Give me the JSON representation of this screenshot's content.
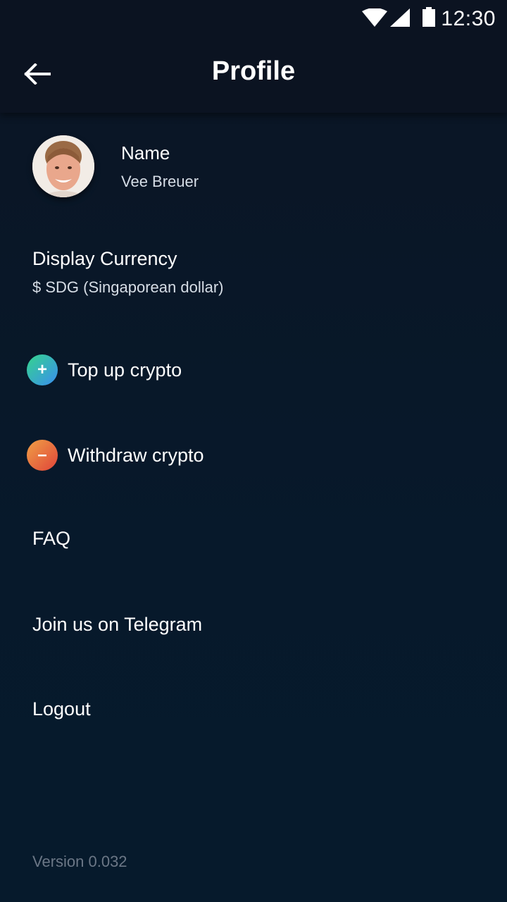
{
  "status_bar": {
    "time": "12:30",
    "icons": [
      "wifi-icon",
      "cell-signal-icon",
      "battery-icon"
    ]
  },
  "header": {
    "title": "Profile",
    "back_icon": "arrow-left-icon"
  },
  "profile": {
    "name_label": "Name",
    "name_value": "Vee Breuer"
  },
  "currency": {
    "label": "Display Currency",
    "value": "$ SDG (Singaporean dollar)"
  },
  "menu": {
    "top_up": {
      "label": "Top up crypto",
      "icon": "plus-icon",
      "icon_glyph": "+"
    },
    "withdraw": {
      "label": "Withdraw crypto",
      "icon": "minus-icon",
      "icon_glyph": "–"
    },
    "faq": {
      "label": "FAQ"
    },
    "telegram": {
      "label": "Join us on Telegram"
    },
    "logout": {
      "label": "Logout"
    }
  },
  "footer": {
    "version": "Version 0.032"
  },
  "colors": {
    "background": "#07192b",
    "header": "#0b1321",
    "top_up_gradient": [
      "#35d48c",
      "#3a8ef0"
    ],
    "withdraw_gradient": [
      "#f0a046",
      "#e0443a"
    ],
    "muted_text": "#6b7786"
  }
}
